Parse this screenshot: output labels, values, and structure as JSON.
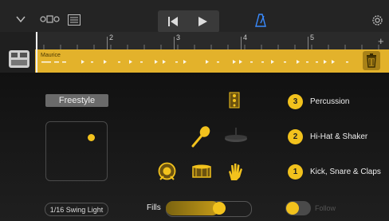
{
  "toolbar": {
    "icons": [
      "tracks-dropdown-icon",
      "smart-controls-icon",
      "mixer-icon",
      "rewind-icon",
      "play-icon",
      "metronome-icon",
      "settings-icon"
    ]
  },
  "ruler": {
    "numbers": [
      "2",
      "3",
      "4",
      "5"
    ]
  },
  "track": {
    "region_name": "Maurice"
  },
  "drummer": {
    "preset_label": "Freestyle",
    "groove_label": "1/16 Swing Light",
    "fills_label": "Fills",
    "fills_level": 0.62,
    "follow_label": "Follow",
    "follow_on": false
  },
  "instrument_groups": [
    {
      "number": "3",
      "label": "Percussion"
    },
    {
      "number": "2",
      "label": "Hi-Hat & Shaker"
    },
    {
      "number": "1",
      "label": "Kick, Snare & Claps"
    }
  ],
  "colors": {
    "accent": "#f2c21d",
    "region": "#e3b22b",
    "background": "#1a1a1a"
  }
}
